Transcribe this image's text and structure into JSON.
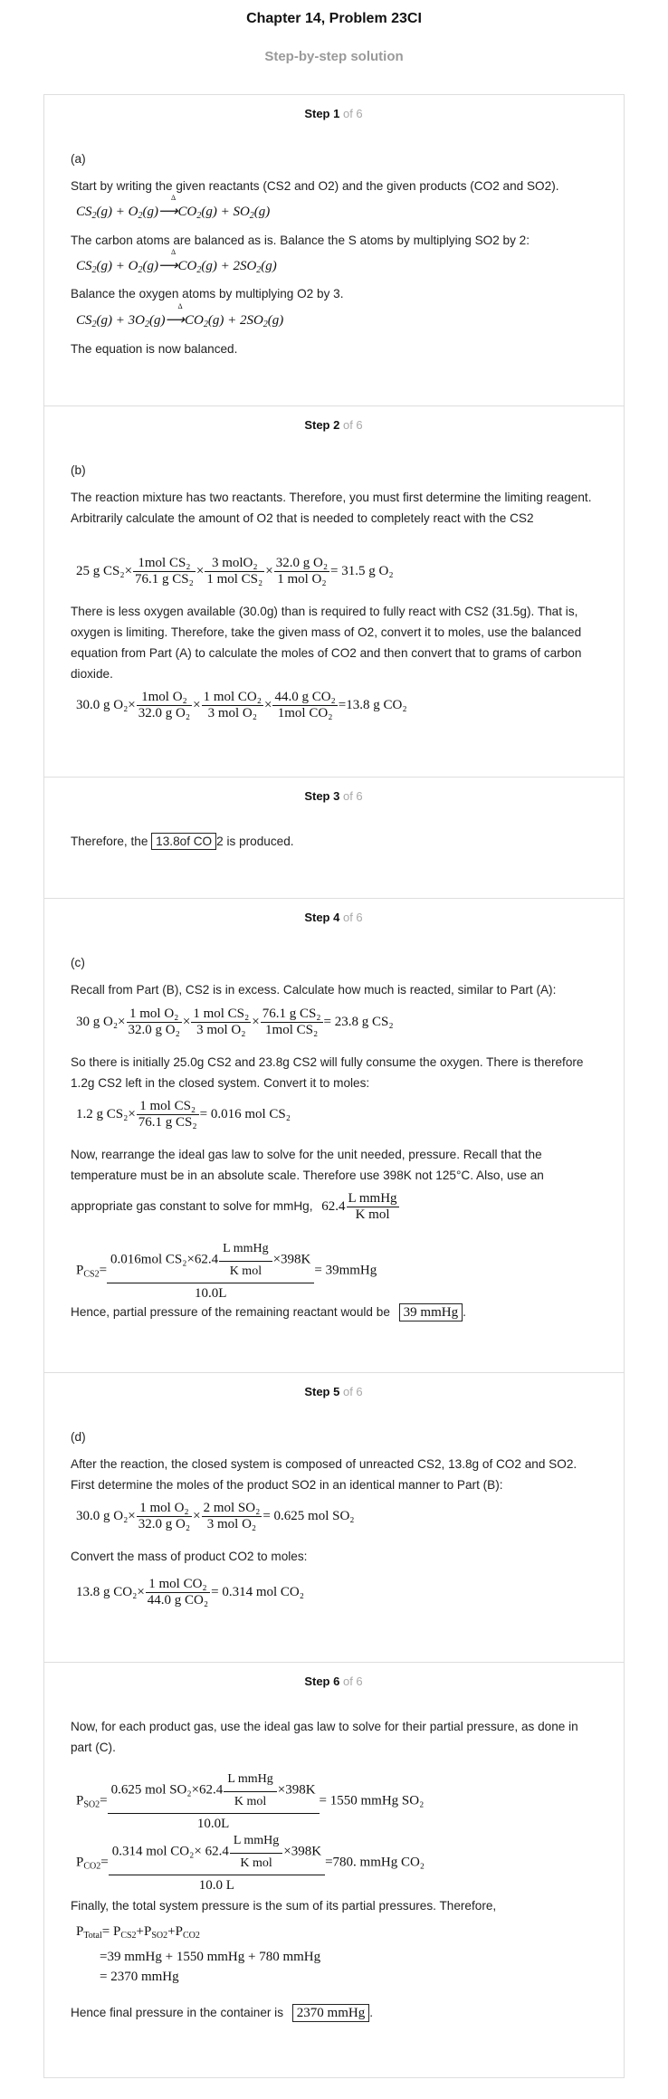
{
  "header": {
    "title": "Chapter 14, Problem 23CI",
    "subtitle": "Step-by-step solution"
  },
  "step_of": "of 6",
  "steps": [
    {
      "label": "Step 1",
      "part": "(a)",
      "p1": "Start by writing the given reactants (CS2 and O2) and the given products (CO2 and SO2).",
      "p2": "The carbon atoms are balanced as is. Balance the S atoms by multiplying SO2 by 2:",
      "p3": "Balance the oxygen atoms by multiplying O2 by 3.",
      "p4": "The equation is now balanced."
    },
    {
      "label": "Step 2",
      "part": "(b)",
      "p1": "The reaction mixture has two reactants. Therefore, you must first determine the limiting reagent. Arbitrarily calculate the amount of O2 that is needed to completely react with the CS2",
      "p2": "There is less oxygen available (30.0g) than is required to fully react with CS2 (31.5g). That is, oxygen is limiting. Therefore, take the given mass of O2, convert it to moles, use the balanced equation from Part (A) to calculate the moles of CO2 and then convert that to grams of carbon dioxide."
    },
    {
      "label": "Step 3",
      "p1_pre": "Therefore, the ",
      "p1_box": "13.8of CO",
      "p1_post": "2 is produced."
    },
    {
      "label": "Step 4",
      "part": "(c)",
      "p1": "Recall from Part (B), CS2 is in excess. Calculate how much is reacted, similar to Part (A):",
      "p2": "So there is initially 25.0g CS2 and 23.8g CS2 will fully consume the oxygen. There is therefore 1.2g CS2 left in the closed system. Convert it to moles:",
      "p3": "Now, rearrange the ideal gas law to solve for the unit needed, pressure. Recall that the temperature must be in an absolute scale. Therefore use 398K not 125°C. Also, use an",
      "p3b": "appropriate gas constant to solve for mmHg,",
      "p4": "Hence, partial pressure of the remaining reactant would be",
      "p4_box": "39 mmHg",
      "p4_end": "."
    },
    {
      "label": "Step 5",
      "part": "(d)",
      "p1": "After the reaction, the closed system is composed of unreacted CS2, 13.8g of CO2 and SO2. First determine the moles of the product SO2 in an identical manner to Part (B):",
      "p2": "Convert the mass of product CO2 to moles:"
    },
    {
      "label": "Step 6",
      "p1": "Now, for each product gas, use the ideal gas law to solve for their partial pressure, as done in part (C).",
      "p2": "Finally, the total system pressure is the sum of its partial pressures. Therefore,",
      "p3": "Hence final pressure in the container is",
      "p3_box": "2370 mmHg",
      "p3_end": "."
    }
  ],
  "equations": {
    "s1_e1": "CS₂(g) + O₂(g) ⟶ CO₂(g) + SO₂(g)",
    "s1_e2": "CS₂(g) + O₂(g) ⟶ CO₂(g) + 2SO₂(g)",
    "s1_e3": "CS₂(g) + 3O₂(g) ⟶ CO₂(g) + 2SO₂(g)",
    "arrow_label": "Δ",
    "s2_e1": {
      "lead": "25 g CS₂×",
      "f1n": "1mol CS₂",
      "f1d": "76.1 g CS₂",
      "f2n": "3 molO₂",
      "f2d": "1 mol CS₂",
      "f3n": "32.0 g O₂",
      "f3d": "1 mol O₂",
      "res": "= 31.5 g O₂"
    },
    "s2_e2": {
      "lead": "30.0 g O₂×",
      "f1n": "1mol O₂",
      "f1d": "32.0 g O₂",
      "f2n": "1 mol CO₂",
      "f2d": "3 mol O₂",
      "f3n": "44.0 g CO₂",
      "f3d": "1mol CO₂",
      "res": "=13.8 g CO₂"
    },
    "s4_e1": {
      "lead": "30 g  O₂×",
      "f1n": "1 mol O₂",
      "f1d": "32.0 g O₂",
      "f2n": "1 mol CS₂",
      "f2d": "3 mol O₂",
      "f3n": "76.1 g CS₂",
      "f3d": "1mol CS₂",
      "res": "= 23.8 g CS₂"
    },
    "s4_e2": {
      "lead": "1.2 g CS₂×",
      "f1n": "1 mol CS₂",
      "f1d": "76.1 g CS₂",
      "res": "= 0.016 mol CS₂"
    },
    "s4_R": {
      "lead": "62.4",
      "fn": "L mmHg",
      "fd": "K mol"
    },
    "s4_P": {
      "lhs": "P",
      "lhs_sub": "CS2",
      "num_a": "0.016mol CS₂×62.4",
      "fn": "L mmHg",
      "fd": "K mol",
      "num_b": "×398K",
      "den": "10.0L",
      "res": "= 39mmHg"
    },
    "s5_e1": {
      "lead": "30.0 g O₂×",
      "f1n": "1 mol O₂",
      "f1d": "32.0 g O₂",
      "f2n": "2 mol SO₂",
      "f2d": "3 mol O₂",
      "res": "= 0.625 mol SO₂"
    },
    "s5_e2": {
      "lead": "13.8 g CO₂×",
      "f1n": "1 mol CO₂",
      "f1d": "44.0 g CO₂",
      "res": "= 0.314 mol CO₂"
    },
    "s6_P1": {
      "lhs": "P",
      "lhs_sub": "SO2",
      "num_a": "0.625 mol SO₂×62.4",
      "fn": "L mmHg",
      "fd": "K mol",
      "num_b": "×398K",
      "den": "10.0L",
      "res": "= 1550 mmHg SO₂"
    },
    "s6_P2": {
      "lhs": "P",
      "lhs_sub": "CO2",
      "num_a": "0.314 mol CO₂× 62.4",
      "fn": "L mmHg",
      "fd": "K mol",
      "num_b": "×398K",
      "den": "10.0 L",
      "res": "=780. mmHg CO₂"
    },
    "s6_tot1": {
      "lhs": "P",
      "lhs_sub": "Total",
      "rhs": "= P",
      "s1": "CS2",
      "plus1": "+P",
      "s2": "SO2",
      "plus2": "+P",
      "s3": "CO2"
    },
    "s6_tot2": "=39 mmHg + 1550 mmHg + 780 mmHg",
    "s6_tot3": "= 2370 mmHg"
  }
}
